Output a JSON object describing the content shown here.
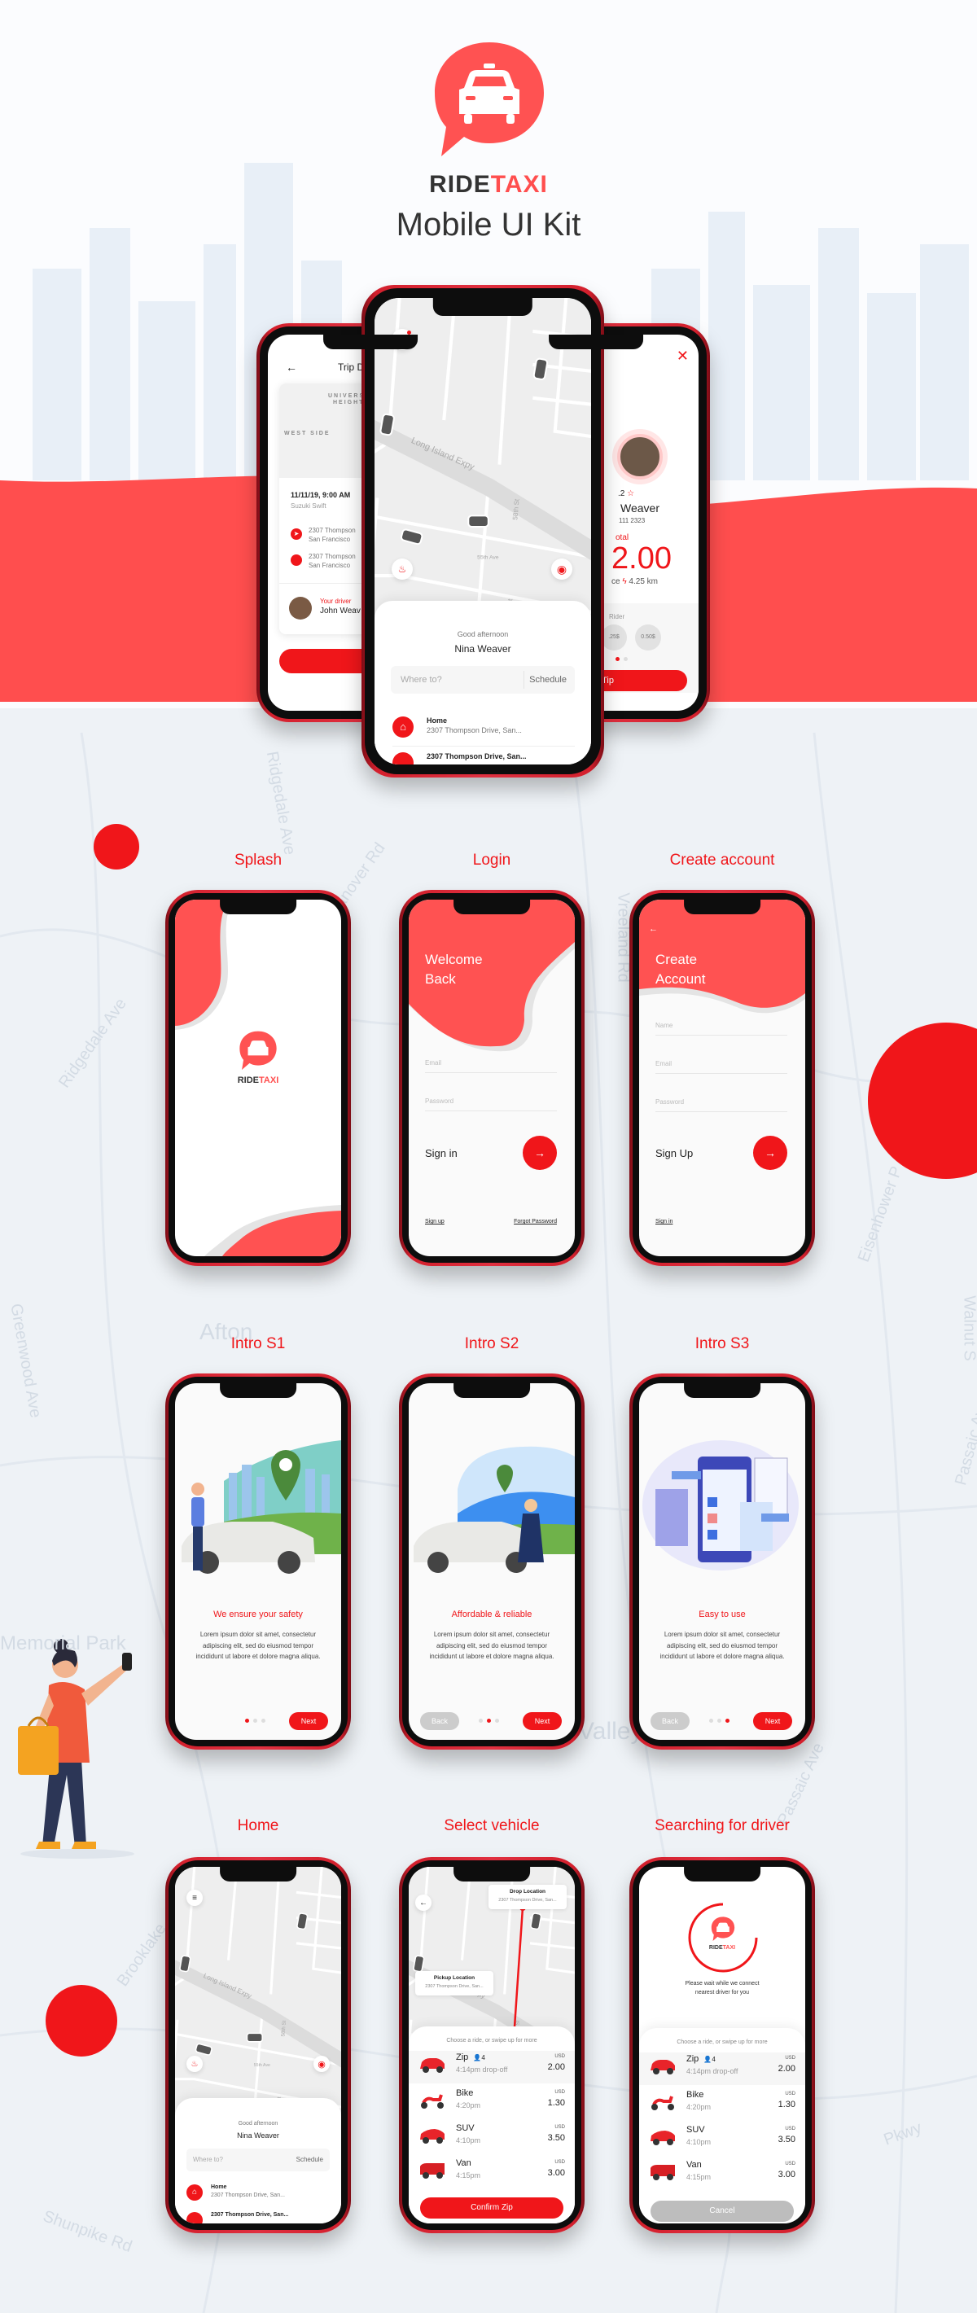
{
  "brand": {
    "ride": "RIDE",
    "taxi": "TAXI",
    "subtitle": "Mobile UI Kit"
  },
  "colors": {
    "accent": "#f0161a",
    "coral": "#ff5252",
    "frame": "#d3202d",
    "background": "#eef2f6"
  },
  "background_streets": [
    "Ridgedale Ave",
    "Hanover Rd",
    "Vreeland Rd",
    "Ridgedale Ave",
    "Eisenhower P",
    "Greenwood Ave",
    "Afton",
    "Walnut S",
    "Passaic Ave",
    "Memorial Park",
    "Valley Wetlands",
    "Brooklake",
    "Shunpike Rd",
    "Passaic Ave",
    "Pkwy"
  ],
  "map": {
    "labels": [
      "Long Island Expy",
      "58th St",
      "55th Ave",
      "58th St",
      "55th Dr",
      "58th Rd",
      "56th Ave"
    ]
  },
  "home": {
    "greeting": "Good afternoon",
    "name": "Nina Weaver",
    "where_placeholder": "Where to?",
    "schedule": "Schedule",
    "places": [
      {
        "title": "Home",
        "address": "2307  Thompson Drive, San..."
      },
      {
        "title": "2307  Thompson Drive, San..."
      }
    ]
  },
  "trip": {
    "title": "Trip D",
    "map_labels": [
      "UNIVERSITY",
      "HEIGHTS",
      "WEST SIDE"
    ],
    "date": "11/11/19, 9:00 AM",
    "car": "Suzuki Swift",
    "stops": [
      {
        "line1": "2307  Thompson",
        "line2": "San Francisco"
      },
      {
        "line1": "2307  Thompson",
        "line2": "San Francisco"
      }
    ],
    "driver_label": "Your driver",
    "driver_name": "John Weav",
    "button": "Go Ba"
  },
  "tip": {
    "rating": ".2",
    "name": "Weaver",
    "phone": "111 2323",
    "total_label": "otal",
    "total": "2.00",
    "distance_prefix": "ce",
    "distance": "4.25 km",
    "rider_label": "Rider",
    "chips": [
      ".25$",
      "0.50$"
    ],
    "button": "firm Tip"
  },
  "sections": {
    "splash": "Splash",
    "login": "Login",
    "create": "Create account",
    "intro1": "Intro S1",
    "intro2": "Intro S2",
    "intro3": "Intro S3",
    "home": "Home",
    "select": "Select vehicle",
    "searching": "Searching for driver"
  },
  "login": {
    "title1": "Welcome",
    "title2": "Back",
    "email": "Email",
    "password": "Password",
    "submit": "Sign in",
    "link_left": "Sign up",
    "link_right": "Forgot Password"
  },
  "signup": {
    "title1": "Create",
    "title2": "Account",
    "name": "Name",
    "email": "Email",
    "password": "Password",
    "submit": "Sign Up",
    "link": "Sign in"
  },
  "intro": [
    {
      "heading": "We ensure your safety",
      "body": [
        "Lorem ipsum dolor sit amet, consectetur",
        "adipiscing elit, sed do eiusmod tempor",
        "incididunt ut labore et dolore magna aliqua."
      ],
      "next": "Next",
      "active": 0
    },
    {
      "heading": "Affordable & reliable",
      "body": [
        "Lorem ipsum dolor sit amet, consectetur",
        "adipiscing elit, sed do eiusmod tempor",
        "incididunt ut labore et dolore magna aliqua."
      ],
      "back": "Back",
      "next": "Next",
      "active": 1
    },
    {
      "heading": "Easy to use",
      "body": [
        "Lorem ipsum dolor sit amet, consectetur",
        "adipiscing elit, sed do eiusmod tempor",
        "incididunt ut labore et dolore magna aliqua."
      ],
      "back": "Back",
      "next": "Next",
      "active": 2
    }
  ],
  "select": {
    "drop_label": "Drop Location",
    "drop_addr": "2307  Thompson Drive, San...",
    "pickup_label": "Pickup Location",
    "pickup_addr": "2307  Thompson Drive, San...",
    "hint": "Choose a ride, or swipe up for more",
    "confirm": "Confirm Zip"
  },
  "vehicles": [
    {
      "name": "Zip",
      "seats": "4",
      "time": "4:14pm drop-off",
      "currency": "USD",
      "price": "2.00"
    },
    {
      "name": "Bike",
      "time": "4:20pm",
      "currency": "USD",
      "price": "1.30"
    },
    {
      "name": "SUV",
      "time": "4:10pm",
      "currency": "USD",
      "price": "3.50"
    },
    {
      "name": "Van",
      "time": "4:15pm",
      "currency": "USD",
      "price": "3.00"
    }
  ],
  "searching": {
    "wait_line1": "Please wait while we connect",
    "wait_line2": "nearest driver for you",
    "hint": "Choose a ride, or swipe up for more",
    "cancel": "Cancel"
  }
}
